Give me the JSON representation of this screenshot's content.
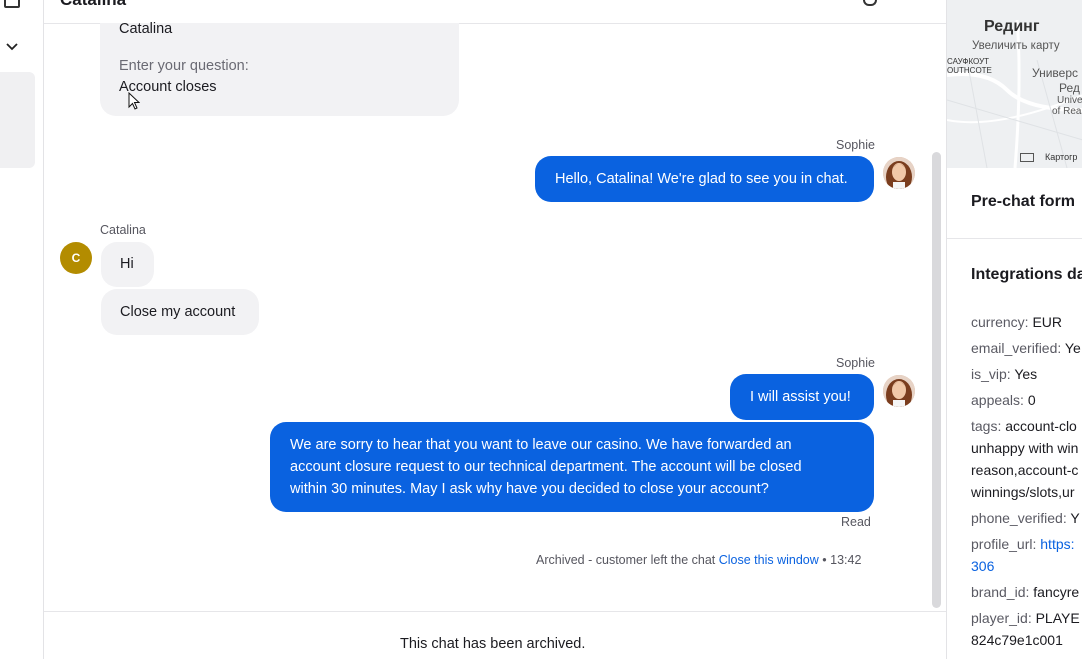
{
  "topbar": {
    "title": "Catalina"
  },
  "messages": {
    "prechat": {
      "name": "Catalina",
      "question_label": "Enter your question:",
      "question_value": "Account closes"
    },
    "agent1": {
      "sender": "Sophie",
      "text": "Hello, Catalina! We're glad to see you in chat."
    },
    "customer": {
      "sender": "Catalina",
      "avatar_initial": "C",
      "msg1": "Hi",
      "msg2": "Close my account"
    },
    "agent2": {
      "sender": "Sophie",
      "text1": "I will assist you!",
      "text2_line1": "We are sorry to hear that you want to leave our casino. We have forwarded an",
      "text2_line2": "account closure request to our technical department. The account will be closed",
      "text2_line3": "within 30 minutes. May I ask why have you decided to close your account?",
      "status": "Read"
    },
    "system": {
      "text": "Archived - customer left the chat",
      "link": "Close this window",
      "time": "• 13:42"
    }
  },
  "footer": {
    "archived_text": "This chat has been archived."
  },
  "right_panel": {
    "map": {
      "city": "Рединг",
      "enlarge": "Увеличить карту",
      "label1": "САУФКОУТ",
      "label2": "OUTHCOTE",
      "label3": "Универс",
      "label4": "Ред",
      "label5": "Unive",
      "label6": "of Rea",
      "attribution": "Картогр"
    },
    "prechat_title": "Pre-chat form",
    "integrations_title": "Integrations da",
    "fields": [
      {
        "key": "currency:",
        "value": "EUR"
      },
      {
        "key": "email_verified:",
        "value": "Ye"
      },
      {
        "key": "is_vip:",
        "value": "Yes"
      },
      {
        "key": "appeals:",
        "value": "0"
      },
      {
        "key": "tags:",
        "value": "account-clo"
      },
      {
        "key": "",
        "value": "unhappy with win"
      },
      {
        "key": "",
        "value": "reason,account-c"
      },
      {
        "key": "",
        "value": "winnings/slots,ur"
      },
      {
        "key": "phone_verified:",
        "value": "Y"
      },
      {
        "key": "profile_url:",
        "value": "https:"
      },
      {
        "key": "",
        "value": "306"
      },
      {
        "key": "brand_id:",
        "value": "fancyre"
      },
      {
        "key": "player_id:",
        "value": "PLAYE"
      },
      {
        "key": "",
        "value": "824c79e1c001"
      }
    ]
  },
  "colors": {
    "accent": "#0a62e0",
    "customer_avatar": "#b38c00"
  }
}
